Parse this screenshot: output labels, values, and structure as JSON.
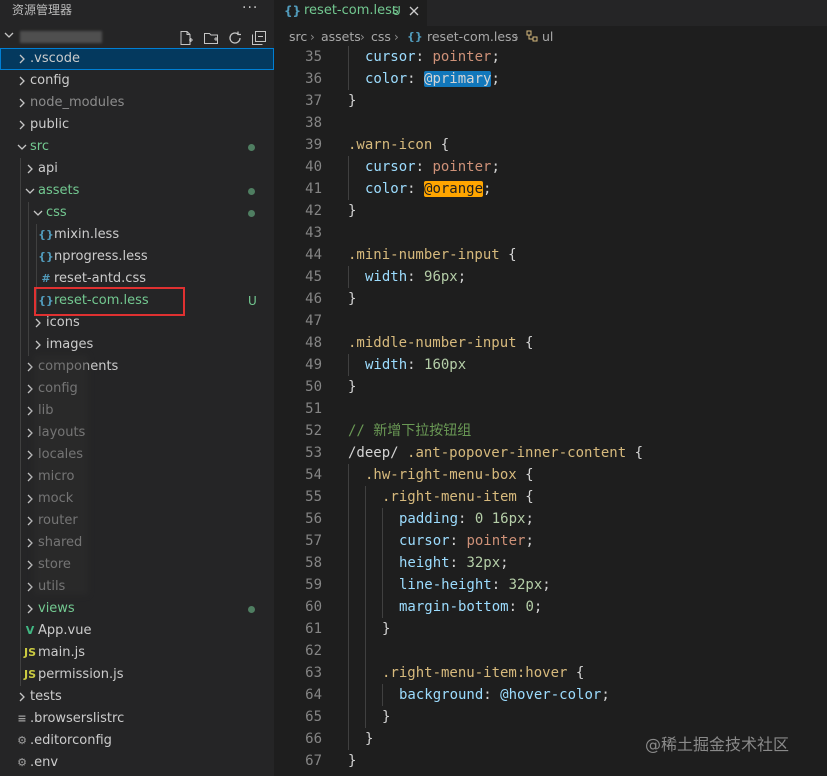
{
  "sidebar": {
    "title": "资源管理器",
    "more": "···",
    "tree": [
      {
        "label": ".vscode",
        "type": "folder",
        "depth": 0,
        "expanded": false,
        "selected": true,
        "color": "#cccccc"
      },
      {
        "label": "config",
        "type": "folder",
        "depth": 0,
        "expanded": false,
        "color": "#cccccc"
      },
      {
        "label": "node_modules",
        "type": "folder",
        "depth": 0,
        "expanded": false,
        "color": "#8c8c8c"
      },
      {
        "label": "public",
        "type": "folder",
        "depth": 0,
        "expanded": false,
        "color": "#cccccc"
      },
      {
        "label": "src",
        "type": "folder",
        "depth": 0,
        "expanded": true,
        "color": "#73c991",
        "dot": "#73c991"
      },
      {
        "label": "api",
        "type": "folder",
        "depth": 1,
        "expanded": false,
        "color": "#cccccc"
      },
      {
        "label": "assets",
        "type": "folder",
        "depth": 1,
        "expanded": true,
        "color": "#73c991",
        "dot": "#73c991"
      },
      {
        "label": "css",
        "type": "folder",
        "depth": 2,
        "expanded": true,
        "color": "#73c991",
        "dot": "#73c991"
      },
      {
        "label": "mixin.less",
        "type": "file",
        "icon": "{}",
        "iconName": "less-file-icon",
        "iconColor": "#519aba",
        "depth": 3,
        "color": "#cccccc"
      },
      {
        "label": "nprogress.less",
        "type": "file",
        "icon": "{}",
        "iconName": "less-file-icon",
        "iconColor": "#519aba",
        "depth": 3,
        "color": "#cccccc"
      },
      {
        "label": "reset-antd.css",
        "type": "file",
        "icon": "#",
        "iconName": "css-file-icon",
        "iconColor": "#519aba",
        "depth": 3,
        "color": "#cccccc"
      },
      {
        "label": "reset-com.less",
        "type": "file",
        "icon": "{}",
        "iconName": "less-file-icon",
        "iconColor": "#519aba",
        "depth": 3,
        "color": "#73c991",
        "badge": "U"
      },
      {
        "label": "icons",
        "type": "folder",
        "depth": 2,
        "expanded": false,
        "color": "#cccccc"
      },
      {
        "label": "images",
        "type": "folder",
        "depth": 2,
        "expanded": false,
        "color": "#cccccc"
      },
      {
        "label": "components",
        "type": "folder",
        "depth": 1,
        "expanded": false,
        "color": "#cccccc"
      },
      {
        "label": "config",
        "type": "folder",
        "depth": 1,
        "expanded": false,
        "color": "#cccccc"
      },
      {
        "label": "lib",
        "type": "folder",
        "depth": 1,
        "expanded": false,
        "color": "#cccccc"
      },
      {
        "label": "layouts",
        "type": "folder",
        "depth": 1,
        "expanded": false,
        "color": "#cccccc"
      },
      {
        "label": "locales",
        "type": "folder",
        "depth": 1,
        "expanded": false,
        "color": "#cccccc"
      },
      {
        "label": "micro",
        "type": "folder",
        "depth": 1,
        "expanded": false,
        "color": "#cccccc"
      },
      {
        "label": "mock",
        "type": "folder",
        "depth": 1,
        "expanded": false,
        "color": "#cccccc"
      },
      {
        "label": "router",
        "type": "folder",
        "depth": 1,
        "expanded": false,
        "color": "#cccccc"
      },
      {
        "label": "shared",
        "type": "folder",
        "depth": 1,
        "expanded": false,
        "color": "#cccccc"
      },
      {
        "label": "store",
        "type": "folder",
        "depth": 1,
        "expanded": false,
        "color": "#cccccc"
      },
      {
        "label": "utils",
        "type": "folder",
        "depth": 1,
        "expanded": false,
        "color": "#cccccc"
      },
      {
        "label": "views",
        "type": "folder",
        "depth": 1,
        "expanded": false,
        "color": "#73c991",
        "dot": "#73c991"
      },
      {
        "label": "App.vue",
        "type": "file",
        "icon": "V",
        "iconName": "vue-file-icon",
        "iconColor": "#41b883",
        "depth": 1,
        "color": "#cccccc"
      },
      {
        "label": "main.js",
        "type": "file",
        "icon": "JS",
        "iconName": "js-file-icon",
        "iconColor": "#cbcb41",
        "depth": 1,
        "color": "#cccccc"
      },
      {
        "label": "permission.js",
        "type": "file",
        "icon": "JS",
        "iconName": "js-file-icon",
        "iconColor": "#cbcb41",
        "depth": 1,
        "color": "#cccccc"
      },
      {
        "label": "tests",
        "type": "folder",
        "depth": 0,
        "expanded": false,
        "color": "#cccccc"
      },
      {
        "label": ".browserslistrc",
        "type": "file",
        "icon": "≡",
        "iconName": "config-file-icon",
        "iconColor": "#a0a0a0",
        "depth": 0,
        "color": "#cccccc"
      },
      {
        "label": ".editorconfig",
        "type": "file",
        "icon": "⚙",
        "iconName": "gear-icon",
        "iconColor": "#a0a0a0",
        "depth": 0,
        "color": "#cccccc"
      },
      {
        "label": ".env",
        "type": "file",
        "icon": "⚙",
        "iconName": "gear-icon",
        "iconColor": "#a0a0a0",
        "depth": 0,
        "color": "#cccccc"
      }
    ]
  },
  "editor": {
    "tab": {
      "icon": "{}",
      "label": "reset-com.less",
      "badge": "U"
    },
    "breadcrumb": [
      "src",
      "assets",
      "css",
      "reset-com.less",
      "ul"
    ],
    "breadcrumb_file_icon": "{}",
    "lines": [
      {
        "n": "35",
        "indent": 1,
        "tokens": [
          [
            "prop",
            "cursor"
          ],
          [
            "pun",
            ": "
          ],
          [
            "val",
            "pointer"
          ],
          [
            "pun",
            ";"
          ]
        ]
      },
      {
        "n": "36",
        "indent": 1,
        "tokens": [
          [
            "prop",
            "color"
          ],
          [
            "pun",
            ": "
          ],
          [
            "hlblue",
            "@primary"
          ],
          [
            "pun",
            ";"
          ]
        ]
      },
      {
        "n": "37",
        "indent": 0,
        "tokens": [
          [
            "pun",
            "}"
          ]
        ]
      },
      {
        "n": "38",
        "indent": 0,
        "tokens": []
      },
      {
        "n": "39",
        "indent": 0,
        "tokens": [
          [
            "sel",
            ".warn-icon"
          ],
          [
            "pun",
            " {"
          ]
        ]
      },
      {
        "n": "40",
        "indent": 1,
        "tokens": [
          [
            "prop",
            "cursor"
          ],
          [
            "pun",
            ": "
          ],
          [
            "val",
            "pointer"
          ],
          [
            "pun",
            ";"
          ]
        ]
      },
      {
        "n": "41",
        "indent": 1,
        "tokens": [
          [
            "prop",
            "color"
          ],
          [
            "pun",
            ": "
          ],
          [
            "hlorange",
            "@orange"
          ],
          [
            "pun",
            ";"
          ]
        ]
      },
      {
        "n": "42",
        "indent": 0,
        "tokens": [
          [
            "pun",
            "}"
          ]
        ]
      },
      {
        "n": "43",
        "indent": 0,
        "tokens": []
      },
      {
        "n": "44",
        "indent": 0,
        "tokens": [
          [
            "sel",
            ".mini-number-input"
          ],
          [
            "pun",
            " {"
          ]
        ]
      },
      {
        "n": "45",
        "indent": 1,
        "tokens": [
          [
            "prop",
            "width"
          ],
          [
            "pun",
            ": "
          ],
          [
            "num",
            "96px"
          ],
          [
            "pun",
            ";"
          ]
        ]
      },
      {
        "n": "46",
        "indent": 0,
        "tokens": [
          [
            "pun",
            "}"
          ]
        ]
      },
      {
        "n": "47",
        "indent": 0,
        "tokens": []
      },
      {
        "n": "48",
        "indent": 0,
        "tokens": [
          [
            "sel",
            ".middle-number-input"
          ],
          [
            "pun",
            " {"
          ]
        ]
      },
      {
        "n": "49",
        "indent": 1,
        "tokens": [
          [
            "prop",
            "width"
          ],
          [
            "pun",
            ": "
          ],
          [
            "num",
            "160px"
          ]
        ]
      },
      {
        "n": "50",
        "indent": 0,
        "tokens": [
          [
            "pun",
            "}"
          ]
        ]
      },
      {
        "n": "51",
        "indent": 0,
        "tokens": []
      },
      {
        "n": "52",
        "indent": 0,
        "tokens": [
          [
            "cmt",
            "// 新增下拉按钮组"
          ]
        ]
      },
      {
        "n": "53",
        "indent": 0,
        "tokens": [
          [
            "pun",
            "/deep/ "
          ],
          [
            "sel",
            ".ant-popover-inner-content"
          ],
          [
            "pun",
            " {"
          ]
        ]
      },
      {
        "n": "54",
        "indent": 1,
        "tokens": [
          [
            "sel",
            ".hw-right-menu-box"
          ],
          [
            "pun",
            " {"
          ]
        ]
      },
      {
        "n": "55",
        "indent": 2,
        "tokens": [
          [
            "sel",
            ".right-menu-item"
          ],
          [
            "pun",
            " {"
          ]
        ]
      },
      {
        "n": "56",
        "indent": 3,
        "tokens": [
          [
            "prop",
            "padding"
          ],
          [
            "pun",
            ": "
          ],
          [
            "num",
            "0"
          ],
          [
            "pun",
            " "
          ],
          [
            "num",
            "16px"
          ],
          [
            "pun",
            ";"
          ]
        ]
      },
      {
        "n": "57",
        "indent": 3,
        "tokens": [
          [
            "prop",
            "cursor"
          ],
          [
            "pun",
            ": "
          ],
          [
            "val",
            "pointer"
          ],
          [
            "pun",
            ";"
          ]
        ]
      },
      {
        "n": "58",
        "indent": 3,
        "tokens": [
          [
            "prop",
            "height"
          ],
          [
            "pun",
            ": "
          ],
          [
            "num",
            "32px"
          ],
          [
            "pun",
            ";"
          ]
        ]
      },
      {
        "n": "59",
        "indent": 3,
        "tokens": [
          [
            "prop",
            "line-height"
          ],
          [
            "pun",
            ": "
          ],
          [
            "num",
            "32px"
          ],
          [
            "pun",
            ";"
          ]
        ]
      },
      {
        "n": "60",
        "indent": 3,
        "tokens": [
          [
            "prop",
            "margin-bottom"
          ],
          [
            "pun",
            ": "
          ],
          [
            "num",
            "0"
          ],
          [
            "pun",
            ";"
          ]
        ]
      },
      {
        "n": "61",
        "indent": 2,
        "tokens": [
          [
            "pun",
            "}"
          ]
        ]
      },
      {
        "n": "62",
        "indent": 2,
        "tokens": []
      },
      {
        "n": "63",
        "indent": 2,
        "tokens": [
          [
            "sel",
            ".right-menu-item:hover"
          ],
          [
            "pun",
            " {"
          ]
        ]
      },
      {
        "n": "64",
        "indent": 3,
        "tokens": [
          [
            "prop",
            "background"
          ],
          [
            "pun",
            ": "
          ],
          [
            "var",
            "@hover-color"
          ],
          [
            "pun",
            ";"
          ]
        ]
      },
      {
        "n": "65",
        "indent": 2,
        "tokens": [
          [
            "pun",
            "}"
          ]
        ]
      },
      {
        "n": "66",
        "indent": 1,
        "tokens": [
          [
            "pun",
            "}"
          ]
        ]
      },
      {
        "n": "67",
        "indent": 0,
        "tokens": [
          [
            "pun",
            "}"
          ]
        ]
      }
    ]
  },
  "watermark": "@稀土掘金技术社区",
  "colors": {
    "accent": "#007fd4",
    "untracked": "#73c991",
    "highlight_primary": "#1177bb",
    "highlight_orange": "#ffa500"
  }
}
